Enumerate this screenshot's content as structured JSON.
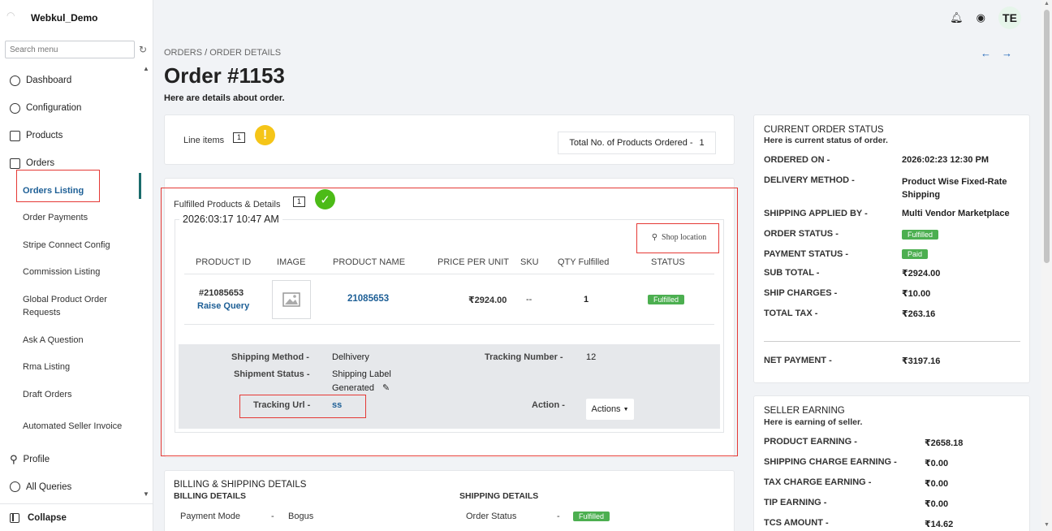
{
  "sidebar": {
    "brand": "Webkul_Demo",
    "search_placeholder": "Search menu",
    "items": [
      {
        "label": "Dashboard"
      },
      {
        "label": "Configuration"
      },
      {
        "label": "Products"
      },
      {
        "label": "Orders"
      }
    ],
    "sub_items": [
      "Orders Listing",
      "Order Payments",
      "Stripe Connect Config",
      "Commission Listing",
      "Global Product Order Requests",
      "Ask A Question",
      "Rma Listing",
      "Draft Orders",
      "Automated Seller Invoice"
    ],
    "bottom_items": [
      {
        "label": "Profile"
      },
      {
        "label": "All Queries"
      }
    ],
    "collapse_label": "Collapse"
  },
  "topbar": {
    "avatar_initials": "TE"
  },
  "breadcrumb": {
    "root": "ORDERS",
    "sep": " / ",
    "current": "ORDER DETAILS"
  },
  "page": {
    "title": "Order #1153",
    "subtitle": "Here are details about order."
  },
  "line_items": {
    "label": "Line items",
    "count": "1",
    "total_label": "Total No. of Products Ordered -",
    "total_value": "1"
  },
  "fulfilled": {
    "label": "Fulfilled Products & Details",
    "count": "1",
    "date": "2026:03:17 10:47 AM",
    "shop_location": "Shop location",
    "columns": [
      "PRODUCT ID",
      "IMAGE",
      "PRODUCT NAME",
      "PRICE PER UNIT",
      "SKU",
      "QTY Fulfilled",
      "STATUS"
    ],
    "row": {
      "product_id": "#21085653",
      "raise_query": "Raise Query",
      "product_name": "21085653",
      "price": "₹2924.00",
      "sku": "--",
      "qty": "1",
      "status": "Fulfilled"
    },
    "shipping": {
      "method_label": "Shipping Method -",
      "method_value": "Delhivery",
      "status_label": "Shipment Status -",
      "status_value_1": "Shipping Label",
      "status_value_2": "Generated",
      "tracking_url_label": "Tracking Url -",
      "tracking_url_value": "ss",
      "tracking_number_label": "Tracking Number -",
      "tracking_number_value": "12",
      "action_label": "Action -",
      "actions_button": "Actions"
    }
  },
  "billing": {
    "title": "BILLING & SHIPPING DETAILS",
    "billing_title": "BILLING DETAILS",
    "shipping_title": "SHIPPING DETAILS",
    "payment_mode_label": "Payment Mode",
    "dash": "-",
    "payment_mode_value": "Bogus",
    "order_status_label": "Order Status",
    "order_status_value": "Fulfilled"
  },
  "current_status": {
    "title": "CURRENT ORDER STATUS",
    "subtitle": "Here is current status of order.",
    "rows": [
      {
        "key": "ORDERED ON -",
        "value": "2026:02:23 12:30 PM"
      },
      {
        "key": "DELIVERY METHOD -",
        "value": "Product Wise Fixed-Rate Shipping"
      },
      {
        "key": "SHIPPING APPLIED BY -",
        "value": "Multi Vendor Marketplace"
      },
      {
        "key": "ORDER STATUS -",
        "value": "Fulfilled"
      },
      {
        "key": "PAYMENT STATUS -",
        "value": "Paid"
      },
      {
        "key": "SUB TOTAL -",
        "value": "₹2924.00"
      },
      {
        "key": "SHIP CHARGES -",
        "value": "₹10.00"
      },
      {
        "key": "TOTAL TAX -",
        "value": "₹263.16"
      }
    ],
    "net_label": "NET PAYMENT -",
    "net_value": "₹3197.16"
  },
  "seller_earning": {
    "title": "SELLER EARNING",
    "subtitle": "Here is earning of seller.",
    "rows": [
      {
        "key": "PRODUCT EARNING -",
        "value": "₹2658.18"
      },
      {
        "key": "SHIPPING CHARGE EARNING -",
        "value": "₹0.00"
      },
      {
        "key": "TAX CHARGE EARNING -",
        "value": "₹0.00"
      },
      {
        "key": "TIP EARNING -",
        "value": "₹0.00"
      },
      {
        "key": "TCS AMOUNT -",
        "value": "₹14.62"
      }
    ]
  },
  "colors": {
    "accent": "#1d5f96",
    "success": "#4caf50",
    "highlight": "#e53935",
    "warning": "#f5c518"
  }
}
